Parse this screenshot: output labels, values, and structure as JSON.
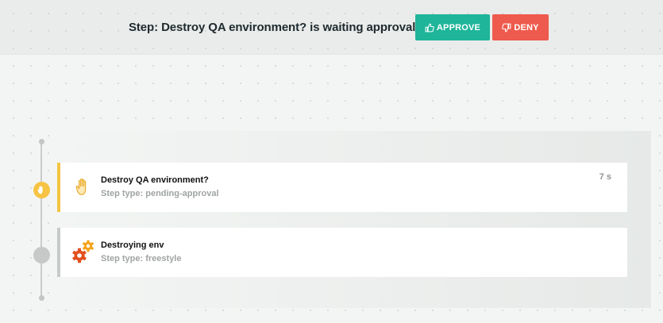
{
  "approval": {
    "title": "Step: Destroy QA environment? is waiting approval",
    "approve_label": "APPROVE",
    "deny_label": "DENY"
  },
  "steps": [
    {
      "name": "Destroy QA environment?",
      "type_label": "Step type: pending-approval",
      "duration": "7 s",
      "status": "pending-approval",
      "icon": "hand-icon",
      "color": "#f3c441"
    },
    {
      "name": "Destroying env",
      "type_label": "Step type: freestyle",
      "duration": "",
      "status": "pending",
      "icon": "gears-icon",
      "color": "#c8cac9"
    }
  ],
  "colors": {
    "approve": "#1fb59a",
    "deny": "#ee5a4d",
    "pending_approval": "#f6c343",
    "gear_orange": "#f5a31a",
    "gear_red": "#e2501e"
  }
}
